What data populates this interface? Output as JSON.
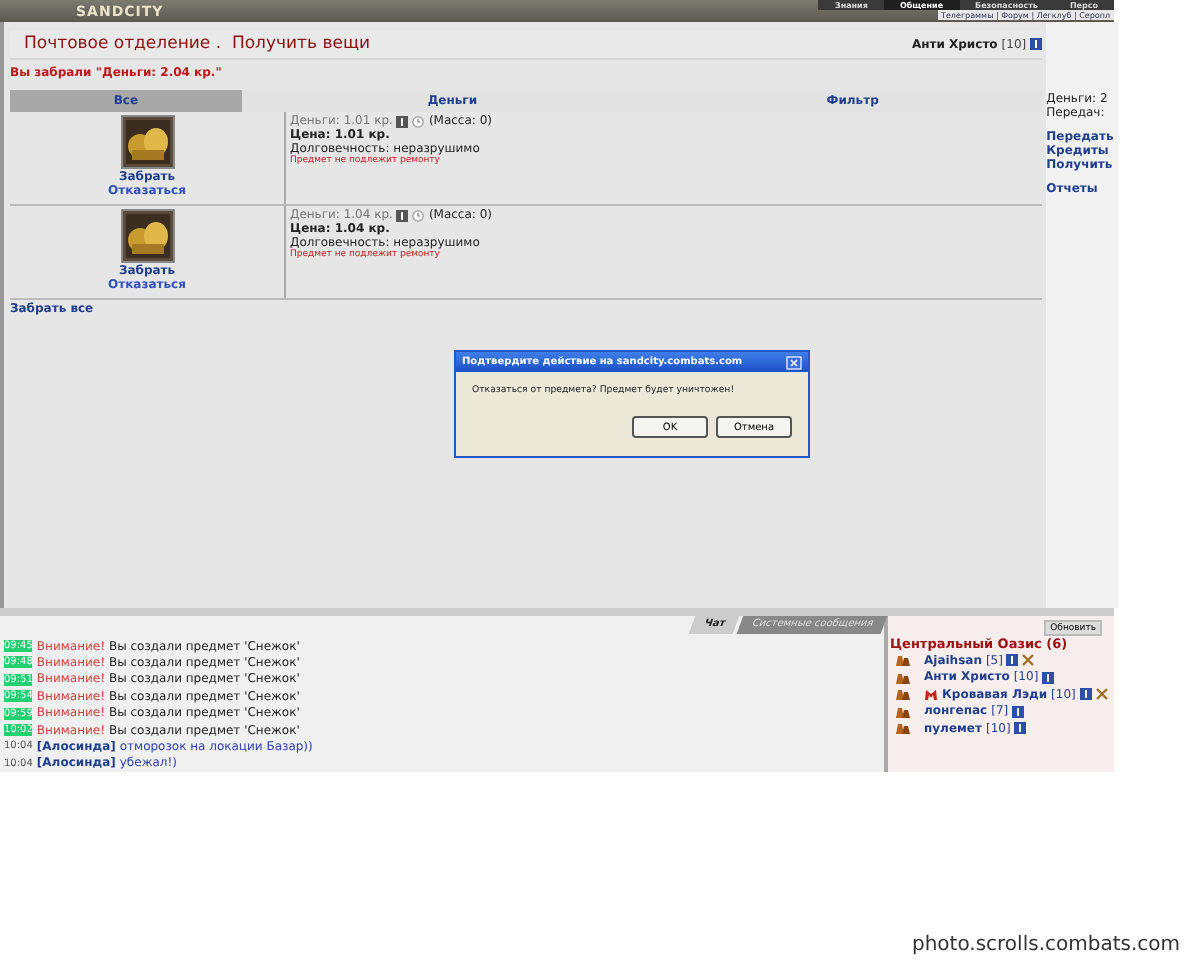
{
  "header": {
    "logo": "SANDCITY",
    "nav": [
      {
        "label": "Знания",
        "selected": false
      },
      {
        "label": "Общение",
        "selected": true
      },
      {
        "label": "Безопасность",
        "selected": false
      },
      {
        "label": "Персо",
        "selected": false
      }
    ],
    "subnav": "Телеграммы | Форум | Легклуб | Серопл"
  },
  "page": {
    "title": "Почтовое отделение .  Получить вещи",
    "user": {
      "name": "Анти Христо",
      "level": "[10]"
    },
    "message": "Вы забрали \"Деньги: 2.04 кр.\""
  },
  "tabs": [
    {
      "label": "Все",
      "selected": true
    },
    {
      "label": "Деньги",
      "selected": false
    },
    {
      "label": "Фильтр",
      "selected": false
    }
  ],
  "items": [
    {
      "name": "Деньги: 1.01 кр.",
      "mass": "(Масса: 0)",
      "price": "Цена: 1.01 кр.",
      "durability": "Долговечность: неразрушимо",
      "note": "Предмет не подлежит ремонту",
      "take": "Забрать",
      "refuse": "Отказаться"
    },
    {
      "name": "Деньги: 1.04 кр.",
      "mass": "(Масса: 0)",
      "price": "Цена: 1.04 кр.",
      "durability": "Долговечность: неразрушимо",
      "note": "Предмет не подлежит ремонту",
      "take": "Забрать",
      "refuse": "Отказаться"
    }
  ],
  "take_all": "Забрать все",
  "side": {
    "lines": [
      "Деньги: 2",
      "Передач:"
    ],
    "links": [
      "Передать",
      "Кредиты",
      "Получить",
      "Отчеты"
    ]
  },
  "dialog": {
    "title": "Подтвердите действие на sandcity.combats.com",
    "text": "Отказаться от предмета? Предмет будет уничтожен!",
    "buttons": [
      "OK",
      "Отмена"
    ]
  },
  "chat_tabs": [
    {
      "label": "Чат",
      "selected": true
    },
    {
      "label": "Системные сообщения",
      "selected": false
    }
  ],
  "chat": [
    {
      "kind": "system",
      "time": "09:45",
      "label": "Внимание!",
      "text": "Вы создали предмет 'Снежок'"
    },
    {
      "kind": "system",
      "time": "09:48",
      "label": "Внимание!",
      "text": "Вы создали предмет 'Снежок'"
    },
    {
      "kind": "system",
      "time": "09:51",
      "label": "Внимание!",
      "text": "Вы создали предмет 'Снежок'"
    },
    {
      "kind": "system",
      "time": "09:54",
      "label": "Внимание!",
      "text": "Вы создали предмет 'Снежок'"
    },
    {
      "kind": "system",
      "time": "09:59",
      "label": "Внимание!",
      "text": "Вы создали предмет 'Снежок'"
    },
    {
      "kind": "system",
      "time": "10:02",
      "label": "Внимание!",
      "text": "Вы создали предмет 'Снежок'"
    },
    {
      "kind": "user",
      "time": "10:04",
      "label": "[Алосинда]",
      "text": "отморозок на локации Базар))"
    },
    {
      "kind": "user",
      "time": "10:04",
      "label": "[Алосинда]",
      "text": "убежал!)"
    }
  ],
  "location": {
    "refresh": "Обновить",
    "title": "Центральный Оазис (6)",
    "users": [
      {
        "name": "Ajaihsan",
        "level": "[5]",
        "clan": false,
        "battle": true
      },
      {
        "name": "Анти Христо",
        "level": "[10]",
        "clan": false,
        "battle": false
      },
      {
        "name": "Кровавая Лэди",
        "level": "[10]",
        "clan": true,
        "battle": true
      },
      {
        "name": "лонгепас",
        "level": "[7]",
        "clan": false,
        "battle": false
      },
      {
        "name": "пулемет",
        "level": "[10]",
        "clan": false,
        "battle": false
      }
    ]
  },
  "footer": "photo.scrolls.combats.com"
}
